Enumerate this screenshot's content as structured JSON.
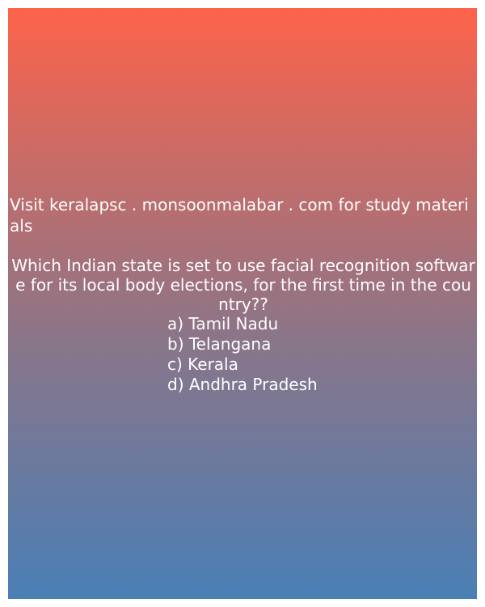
{
  "promo_text": "Visit keralapsc . monsoonmalabar . com for study materials",
  "question": " Which Indian state is set to use facial recognition software for its local body elections, for the first time in the country??",
  "options": [
    "a) Tamil Nadu",
    "b) Telangana",
    "c) Kerala",
    "d) Andhra Pradesh"
  ],
  "colors": {
    "gradient_top": "#fe634a",
    "gradient_bottom": "#4a7fb5",
    "text": "#ffffff"
  }
}
